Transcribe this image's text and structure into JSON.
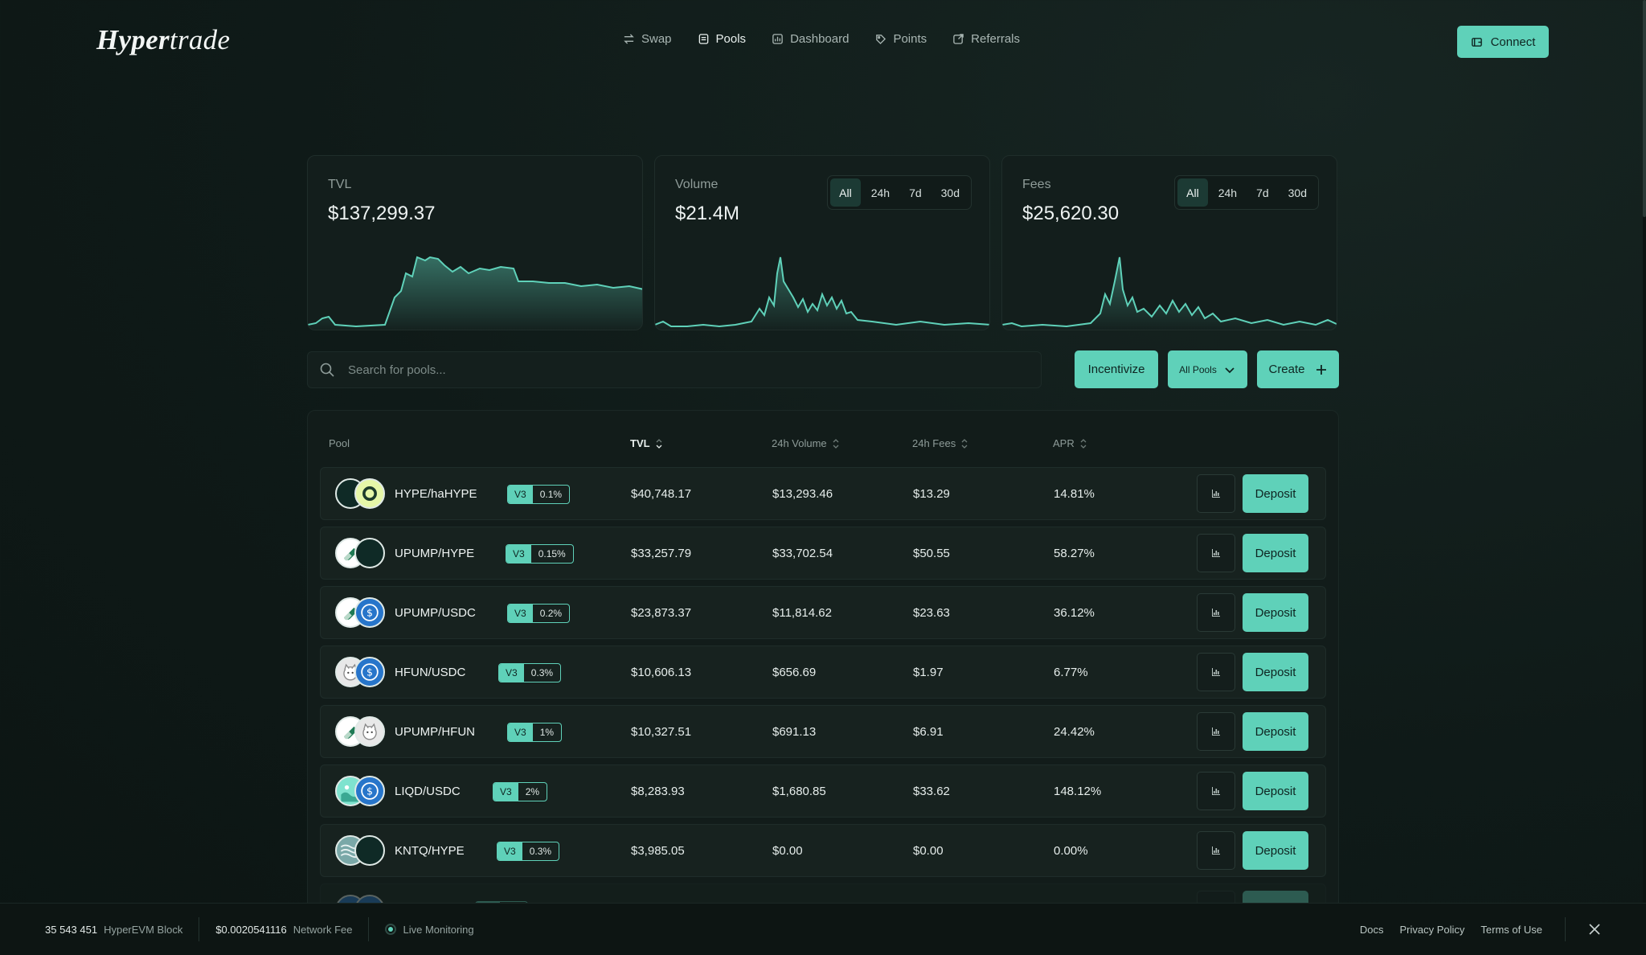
{
  "header": {
    "logo_strong": "Hyper",
    "logo_light": "trade",
    "nav": [
      {
        "label": "Swap",
        "icon": "swap-icon"
      },
      {
        "label": "Pools",
        "icon": "pools-icon",
        "active": true
      },
      {
        "label": "Dashboard",
        "icon": "dashboard-icon"
      },
      {
        "label": "Points",
        "icon": "points-icon"
      },
      {
        "label": "Referrals",
        "icon": "referrals-icon"
      }
    ],
    "connect_label": "Connect"
  },
  "stats": {
    "tvl": {
      "label": "TVL",
      "value": "$137,299.37"
    },
    "volume": {
      "label": "Volume",
      "value": "$21.4M",
      "ranges": [
        "All",
        "24h",
        "7d",
        "30d"
      ],
      "active_range": "All"
    },
    "fees": {
      "label": "Fees",
      "value": "$25,620.30",
      "ranges": [
        "All",
        "24h",
        "7d",
        "30d"
      ],
      "active_range": "All"
    }
  },
  "toolbar": {
    "search_placeholder": "Search for pools...",
    "incentivize_label": "Incentivize",
    "filter_label": "All Pools",
    "create_label": "Create"
  },
  "table": {
    "headers": {
      "pool": "Pool",
      "tvl": "TVL",
      "volume": "24h Volume",
      "fees": "24h Fees",
      "apr": "APR"
    },
    "deposit_label": "Deposit",
    "rows": [
      {
        "pair": "HYPE/haHYPE",
        "version": "V3",
        "fee": "0.1%",
        "tvl": "$40,748.17",
        "volume": "$13,293.46",
        "fees": "$13.29",
        "apr": "14.81%"
      },
      {
        "pair": "UPUMP/HYPE",
        "version": "V3",
        "fee": "0.15%",
        "tvl": "$33,257.79",
        "volume": "$33,702.54",
        "fees": "$50.55",
        "apr": "58.27%"
      },
      {
        "pair": "UPUMP/USDC",
        "version": "V3",
        "fee": "0.2%",
        "tvl": "$23,873.37",
        "volume": "$11,814.62",
        "fees": "$23.63",
        "apr": "36.12%"
      },
      {
        "pair": "HFUN/USDC",
        "version": "V3",
        "fee": "0.3%",
        "tvl": "$10,606.13",
        "volume": "$656.69",
        "fees": "$1.97",
        "apr": "6.77%"
      },
      {
        "pair": "UPUMP/HFUN",
        "version": "V3",
        "fee": "1%",
        "tvl": "$10,327.51",
        "volume": "$691.13",
        "fees": "$6.91",
        "apr": "24.42%"
      },
      {
        "pair": "LIQD/USDC",
        "version": "V3",
        "fee": "2%",
        "tvl": "$8,283.93",
        "volume": "$1,680.85",
        "fees": "$33.62",
        "apr": "148.12%"
      },
      {
        "pair": "KNTQ/HYPE",
        "version": "V3",
        "fee": "0.3%",
        "tvl": "$3,985.05",
        "volume": "$0.00",
        "fees": "$0.00",
        "apr": "0.00%"
      }
    ]
  },
  "footer": {
    "block_value": "35 543 451",
    "block_label": "HyperEVM Block",
    "fee_value": "$0.0020541116",
    "fee_label": "Network Fee",
    "monitoring_label": "Live Monitoring",
    "links": [
      "Docs",
      "Privacy Policy",
      "Terms of Use"
    ]
  },
  "colors": {
    "accent": "#5fd1b9",
    "background": "#0f1a18",
    "card": "#131e1c"
  }
}
